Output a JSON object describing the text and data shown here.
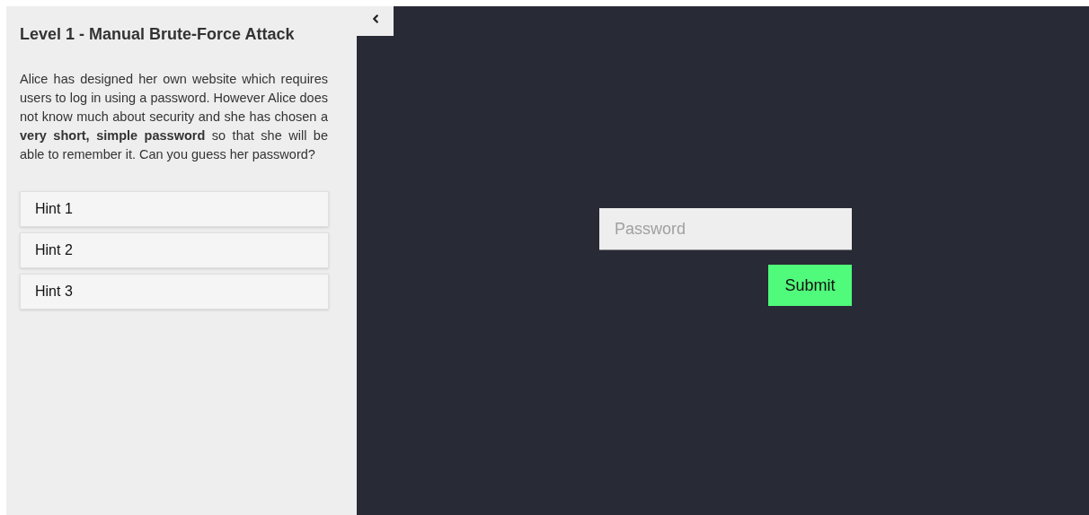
{
  "sidebar": {
    "title": "Level 1 - Manual Brute-Force Attack",
    "description": "Alice has designed her own website which requires users to log in using a password. However Alice does not know much about security and she has chosen a **very short, simple password** so that she will be able to remember it. Can you guess her password?",
    "hints": [
      {
        "label": "Hint 1",
        "expanded": false
      },
      {
        "label": "Hint 2",
        "expanded": false
      },
      {
        "label": "Hint 3",
        "expanded": false
      }
    ]
  },
  "form": {
    "password": {
      "placeholder": "Password"
    },
    "submit": "Submit"
  }
}
